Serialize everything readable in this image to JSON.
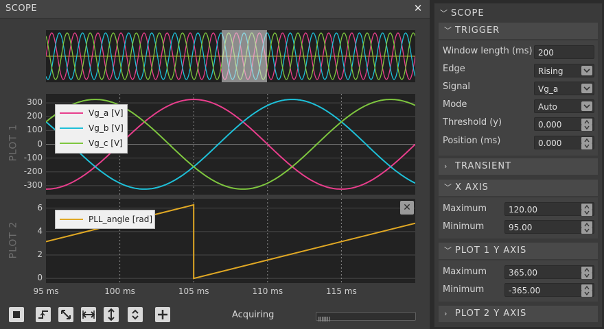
{
  "window": {
    "title": "SCOPE",
    "close_icon": "close-icon"
  },
  "overview": {
    "description_icon": "overview-strip"
  },
  "plot1": {
    "label": "PLOT 1",
    "y_ticks": [
      "300",
      "200",
      "100",
      "0",
      "-100",
      "-200",
      "-300"
    ],
    "legend": [
      {
        "name": "Vg_a",
        "unit": "[V]",
        "color": "#e83e8c"
      },
      {
        "name": "Vg_b",
        "unit": "[V]",
        "color": "#1ec0d8"
      },
      {
        "name": "Vg_c",
        "unit": "[V]",
        "color": "#7ec63f"
      }
    ]
  },
  "plot2": {
    "label": "PLOT 2",
    "y_ticks": [
      "6",
      "4",
      "2",
      "0"
    ],
    "legend": [
      {
        "name": "PLL_angle",
        "unit": "[rad]",
        "color": "#e0a824"
      }
    ],
    "close_label": "✕"
  },
  "x_ticks": [
    "95 ms",
    "100 ms",
    "105 ms",
    "110 ms",
    "115 ms"
  ],
  "toolbar": {
    "buttons": [
      "stop-icon",
      "trigger-edge-icon",
      "zoom-fit-icon",
      "expand-horizontal-icon",
      "expand-vertical-icon",
      "fit-vertical-icon",
      "add-plot-icon"
    ],
    "status": "Acquiring",
    "progress_fraction": 0.2
  },
  "panel": {
    "title": "SCOPE",
    "trigger": {
      "title": "TRIGGER",
      "window_length_label": "Window length (ms)",
      "window_length_value": "200",
      "edge_label": "Edge",
      "edge_value": "Rising",
      "signal_label": "Signal",
      "signal_value": "Vg_a",
      "mode_label": "Mode",
      "mode_value": "Auto",
      "threshold_label": "Threshold (y)",
      "threshold_value": "0.000",
      "position_label": "Position (ms)",
      "position_value": "0.000"
    },
    "transient": {
      "title": "TRANSIENT"
    },
    "x_axis": {
      "title": "X AXIS",
      "max_label": "Maximum",
      "max_value": "120.00",
      "min_label": "Minimum",
      "min_value": "95.00"
    },
    "plot1_y_axis": {
      "title": "PLOT 1 Y AXIS",
      "max_label": "Maximum",
      "max_value": "365.00",
      "min_label": "Minimum",
      "min_value": "-365.00"
    },
    "plot2_y_axis": {
      "title": "PLOT 2 Y AXIS"
    }
  },
  "chart_data": [
    {
      "type": "line",
      "x_range_ms": [
        95,
        120
      ],
      "ylim": [
        -365,
        365
      ],
      "series": [
        {
          "name": "Vg_a",
          "unit": "V",
          "amplitude": 325,
          "frequency_hz": 50,
          "phase_deg": 0
        },
        {
          "name": "Vg_b",
          "unit": "V",
          "amplitude": 325,
          "frequency_hz": 50,
          "phase_deg": -120
        },
        {
          "name": "Vg_c",
          "unit": "V",
          "amplitude": 325,
          "frequency_hz": 50,
          "phase_deg": 120
        }
      ],
      "grid": true,
      "legend_position": "top-left"
    },
    {
      "type": "line",
      "x_range_ms": [
        95,
        120
      ],
      "ylim": [
        -0.4,
        6.8
      ],
      "series": [
        {
          "name": "PLL_angle",
          "unit": "rad",
          "points": [
            [
              95,
              3.14
            ],
            [
              105,
              6.28
            ],
            [
              105,
              0
            ],
            [
              120,
              4.71
            ]
          ]
        }
      ],
      "grid": true,
      "legend_position": "top-left"
    }
  ]
}
